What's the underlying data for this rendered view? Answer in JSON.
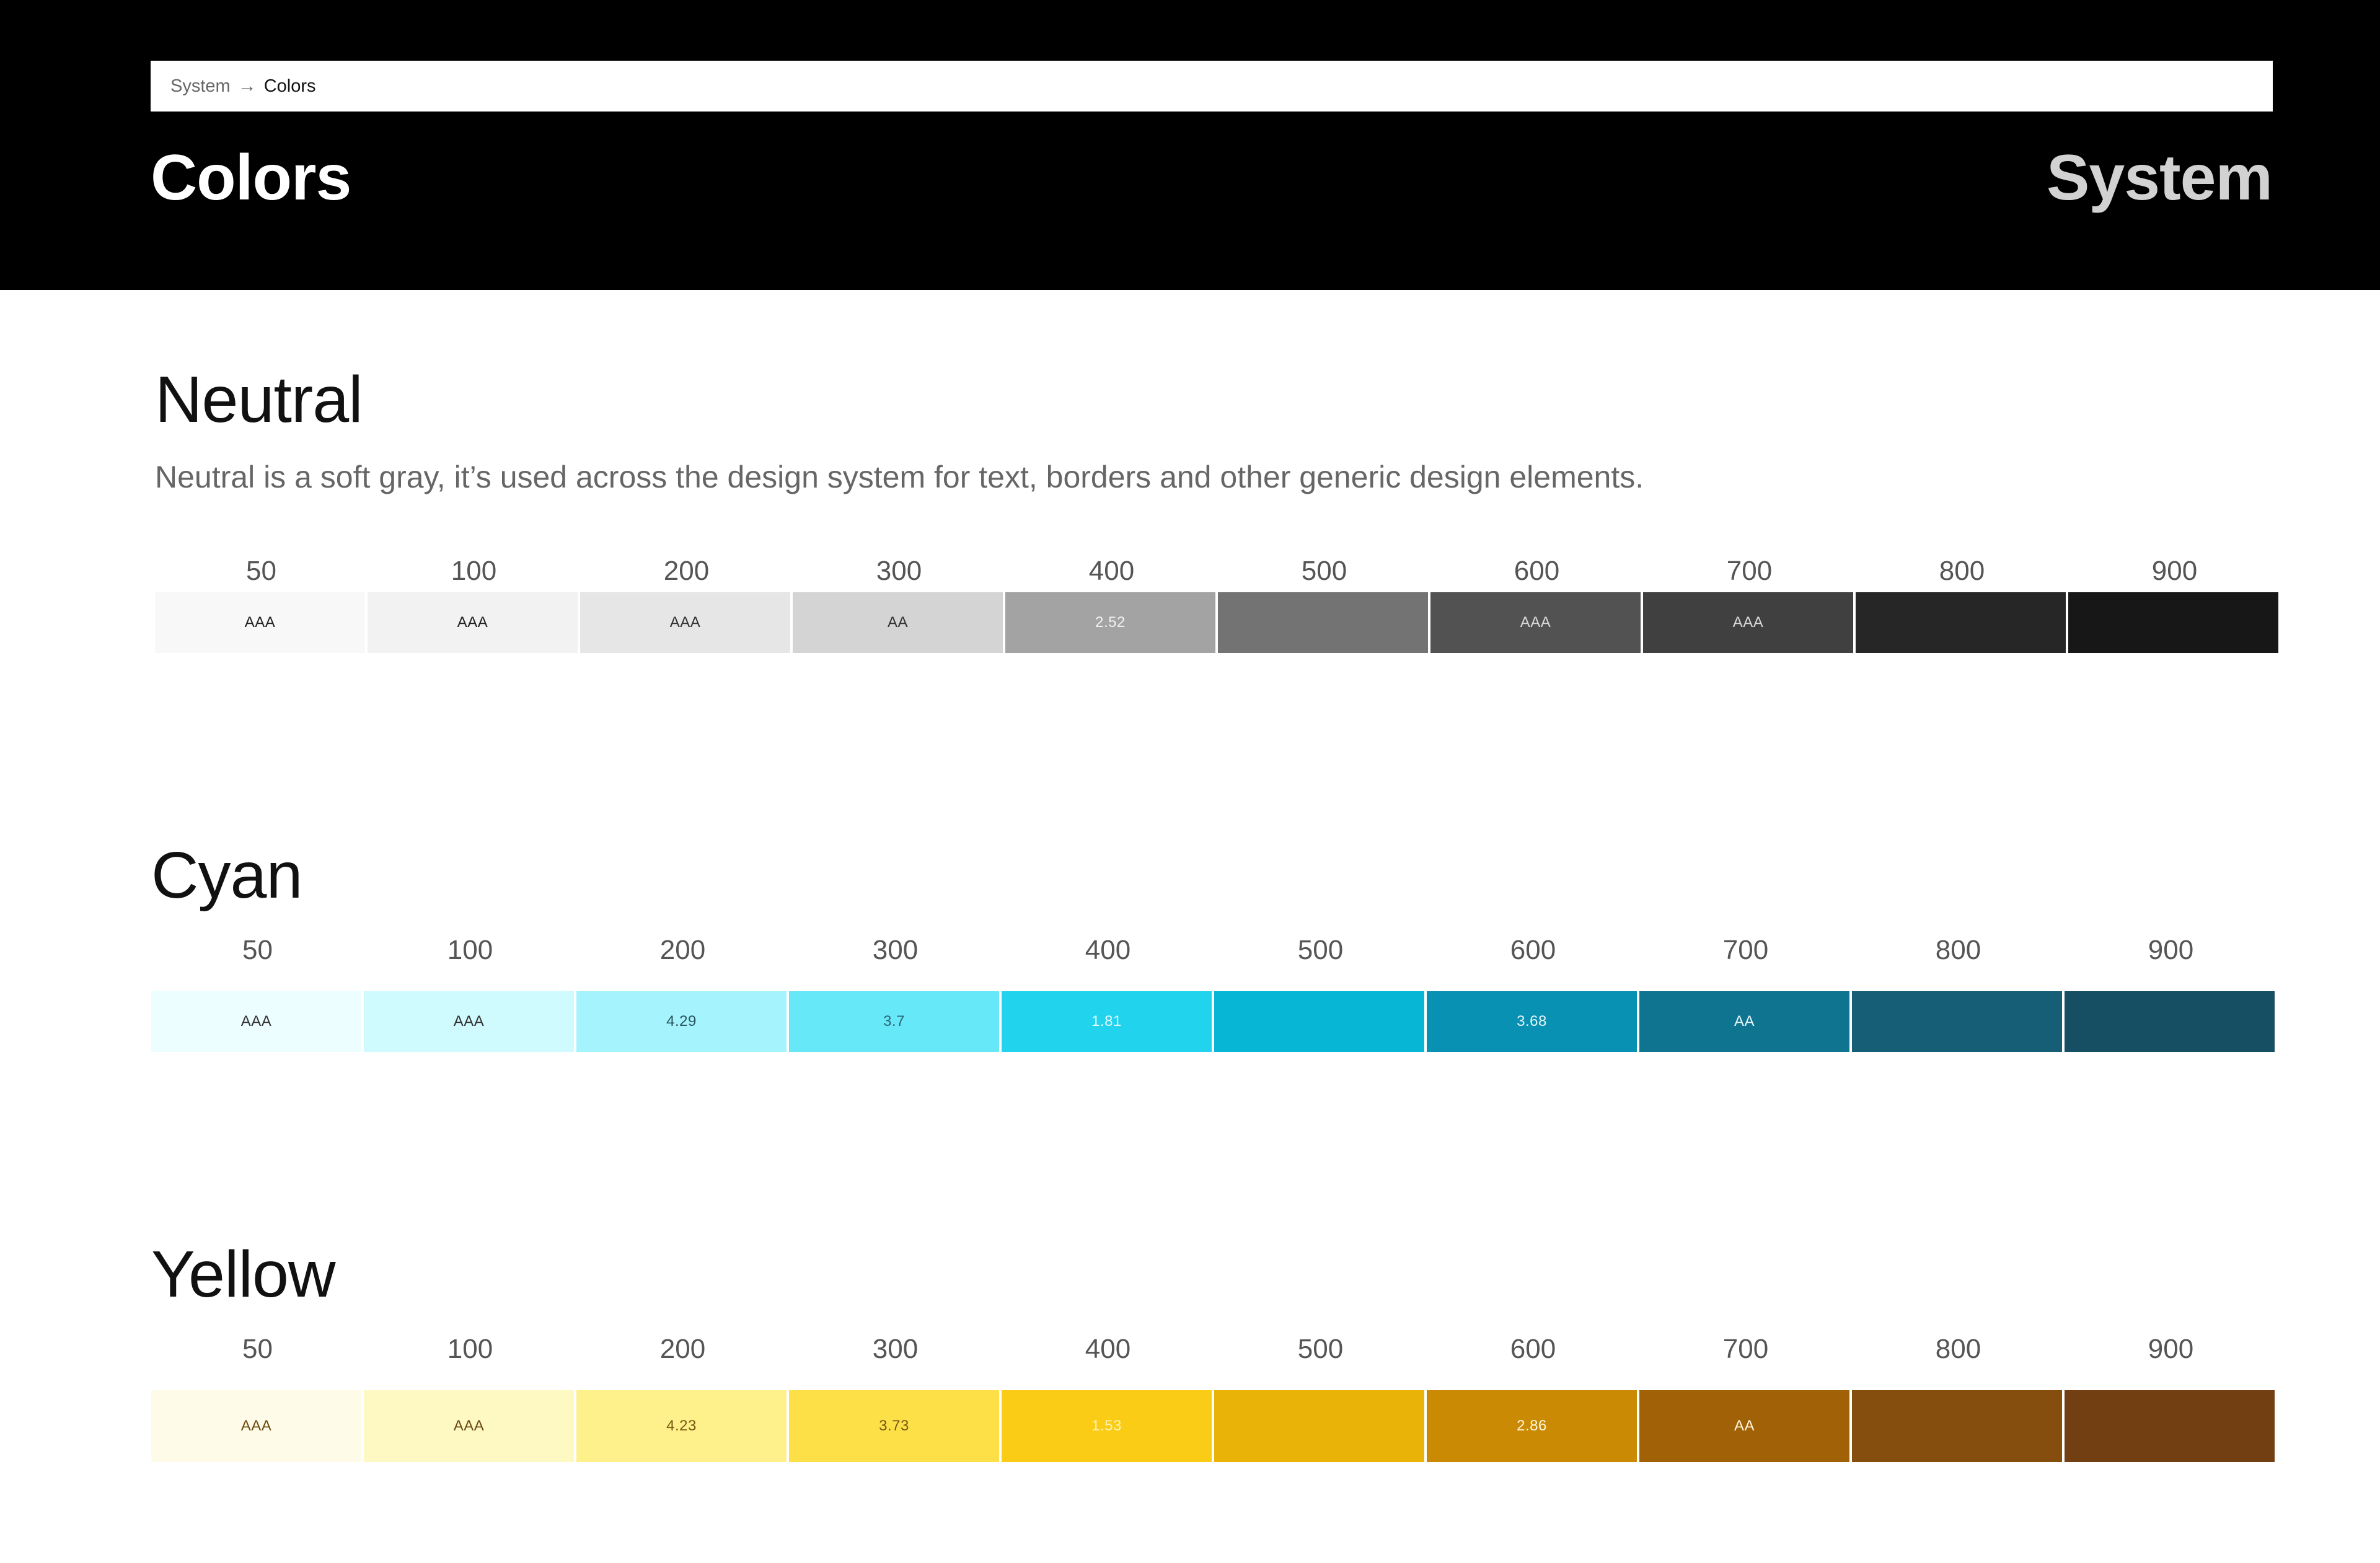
{
  "breadcrumb": {
    "parent": "System",
    "separator": "→",
    "current": "Colors"
  },
  "header": {
    "title": "Colors",
    "system_label": "System"
  },
  "palettes": [
    {
      "id": "neutral",
      "title": "Neutral",
      "description": "Neutral is a soft gray, it’s used across the design system for text, borders and other generic design elements.",
      "swatches": [
        {
          "label": "50",
          "color": "#f8f8f8",
          "text": "AAA",
          "text_color": "#222222"
        },
        {
          "label": "100",
          "color": "#f2f2f2",
          "text": "AAA",
          "text_color": "#222222"
        },
        {
          "label": "200",
          "color": "#e6e6e6",
          "text": "AAA",
          "text_color": "#333333"
        },
        {
          "label": "300",
          "color": "#d4d4d4",
          "text": "AA",
          "text_color": "#333333"
        },
        {
          "label": "400",
          "color": "#a3a3a3",
          "text": "2.52",
          "text_color": "#f2f2f2"
        },
        {
          "label": "500",
          "color": "#737373",
          "text": "",
          "text_color": "#ffffff"
        },
        {
          "label": "600",
          "color": "#525252",
          "text": "AAA",
          "text_color": "#d8d8d8"
        },
        {
          "label": "700",
          "color": "#404040",
          "text": "AAA",
          "text_color": "#d8d8d8"
        },
        {
          "label": "800",
          "color": "#262626",
          "text": "",
          "text_color": "#ffffff"
        },
        {
          "label": "900",
          "color": "#171717",
          "text": "",
          "text_color": "#ffffff"
        }
      ]
    },
    {
      "id": "cyan",
      "title": "Cyan",
      "description": "",
      "swatches": [
        {
          "label": "50",
          "color": "#ecfeff",
          "text": "AAA",
          "text_color": "#333333"
        },
        {
          "label": "100",
          "color": "#cffafe",
          "text": "AAA",
          "text_color": "#333333"
        },
        {
          "label": "200",
          "color": "#a5f3fc",
          "text": "4.29",
          "text_color": "#2a5560"
        },
        {
          "label": "300",
          "color": "#67e8f9",
          "text": "3.7",
          "text_color": "#2a6575"
        },
        {
          "label": "400",
          "color": "#22d3ee",
          "text": "1.81",
          "text_color": "#e6fbff"
        },
        {
          "label": "500",
          "color": "#06b6d4",
          "text": "",
          "text_color": "#ffffff"
        },
        {
          "label": "600",
          "color": "#0891b2",
          "text": "3.68",
          "text_color": "#e6f6fa"
        },
        {
          "label": "700",
          "color": "#0e7490",
          "text": "AA",
          "text_color": "#e6f6fa"
        },
        {
          "label": "800",
          "color": "#155e75",
          "text": "",
          "text_color": "#ffffff"
        },
        {
          "label": "900",
          "color": "#164e63",
          "text": "",
          "text_color": "#ffffff"
        }
      ]
    },
    {
      "id": "yellow",
      "title": "Yellow",
      "description": "",
      "swatches": [
        {
          "label": "50",
          "color": "#fefce8",
          "text": "AAA",
          "text_color": "#6b4a10"
        },
        {
          "label": "100",
          "color": "#fef9c3",
          "text": "AAA",
          "text_color": "#6b4a10"
        },
        {
          "label": "200",
          "color": "#fef08a",
          "text": "4.23",
          "text_color": "#7a5a10"
        },
        {
          "label": "300",
          "color": "#fde047",
          "text": "3.73",
          "text_color": "#7a5a10"
        },
        {
          "label": "400",
          "color": "#facc15",
          "text": "1.53",
          "text_color": "#fff3b0"
        },
        {
          "label": "500",
          "color": "#eab308",
          "text": "",
          "text_color": "#ffffff"
        },
        {
          "label": "600",
          "color": "#ca8a04",
          "text": "2.86",
          "text_color": "#fff6d8"
        },
        {
          "label": "700",
          "color": "#a16207",
          "text": "AA",
          "text_color": "#fff6d8"
        },
        {
          "label": "800",
          "color": "#854d0e",
          "text": "",
          "text_color": "#ffffff"
        },
        {
          "label": "900",
          "color": "#713f12",
          "text": "",
          "text_color": "#ffffff"
        }
      ]
    }
  ]
}
